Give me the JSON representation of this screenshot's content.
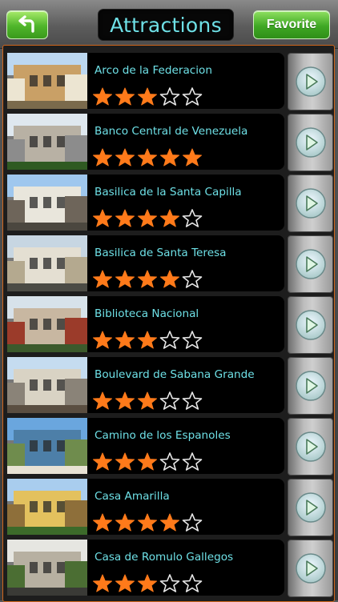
{
  "header": {
    "title": "Attractions",
    "favorite_label": "Favorite",
    "back_icon": "back-arrow-icon",
    "accent_color": "#6ee0e6",
    "button_color": "#4fb52a"
  },
  "star_color": "#ff7a1a",
  "attractions": [
    {
      "name": "Arco de la Federacion",
      "rating": 3,
      "palette": [
        "#bcd7f0",
        "#c9a066",
        "#ece5d2",
        "#7a6a4c"
      ]
    },
    {
      "name": "Banco Central de Venezuela",
      "rating": 5,
      "palette": [
        "#dfe8ef",
        "#b8b1a4",
        "#8c8c8c",
        "#2f5a22"
      ]
    },
    {
      "name": "Basilica de la Santa Capilla",
      "rating": 4,
      "palette": [
        "#9fc7ee",
        "#e9e6dc",
        "#6e655a",
        "#4b473f"
      ]
    },
    {
      "name": "Basilica de Santa Teresa",
      "rating": 4,
      "palette": [
        "#c7d6e2",
        "#e4dfd2",
        "#b4a98f",
        "#4b4b45"
      ]
    },
    {
      "name": "Biblioteca Nacional",
      "rating": 3,
      "palette": [
        "#d7e2ea",
        "#c8b7a1",
        "#9b3b2a",
        "#3c5a2c"
      ]
    },
    {
      "name": "Boulevard de Sabana Grande",
      "rating": 3,
      "palette": [
        "#c5dcf0",
        "#d9d3c4",
        "#8a8378",
        "#5a4e41"
      ]
    },
    {
      "name": "Camino de los Espanoles",
      "rating": 3,
      "palette": [
        "#6aa6de",
        "#4d7fa8",
        "#6f8c4d",
        "#e8e2d4"
      ]
    },
    {
      "name": "Casa Amarilla",
      "rating": 4,
      "palette": [
        "#a9cdee",
        "#e3c15e",
        "#8e6f3a",
        "#3c6a2a"
      ]
    },
    {
      "name": "Casa de Romulo Gallegos",
      "rating": 3,
      "palette": [
        "#e6e6e1",
        "#b7b0a1",
        "#4b6e33",
        "#3a3a36"
      ]
    }
  ]
}
